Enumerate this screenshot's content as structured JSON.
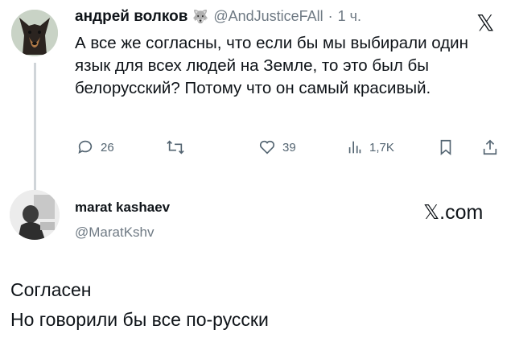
{
  "tweet": {
    "author_name": "андрей волков",
    "handle": "@AndJusticeFAll",
    "separator": "·",
    "time": "1 ч.",
    "text": "А все же согласны, что если бы мы выбирали один язык для всех людей на Земле, то это был бы белорусский? Потому что он самый красивый.",
    "actions": {
      "replies": "26",
      "retweets": "",
      "likes": "39",
      "views": "1,7K"
    },
    "icons": [
      "reply-icon",
      "retweet-icon",
      "like-icon",
      "views-icon",
      "bookmark-icon",
      "share-icon",
      "x-logo-icon"
    ]
  },
  "reply": {
    "author_name": "marat kashaev",
    "handle": "@MaratKshv",
    "brand": "𝕏.com",
    "line1": "Согласен",
    "line2": "Но говорили бы все по-русски"
  }
}
